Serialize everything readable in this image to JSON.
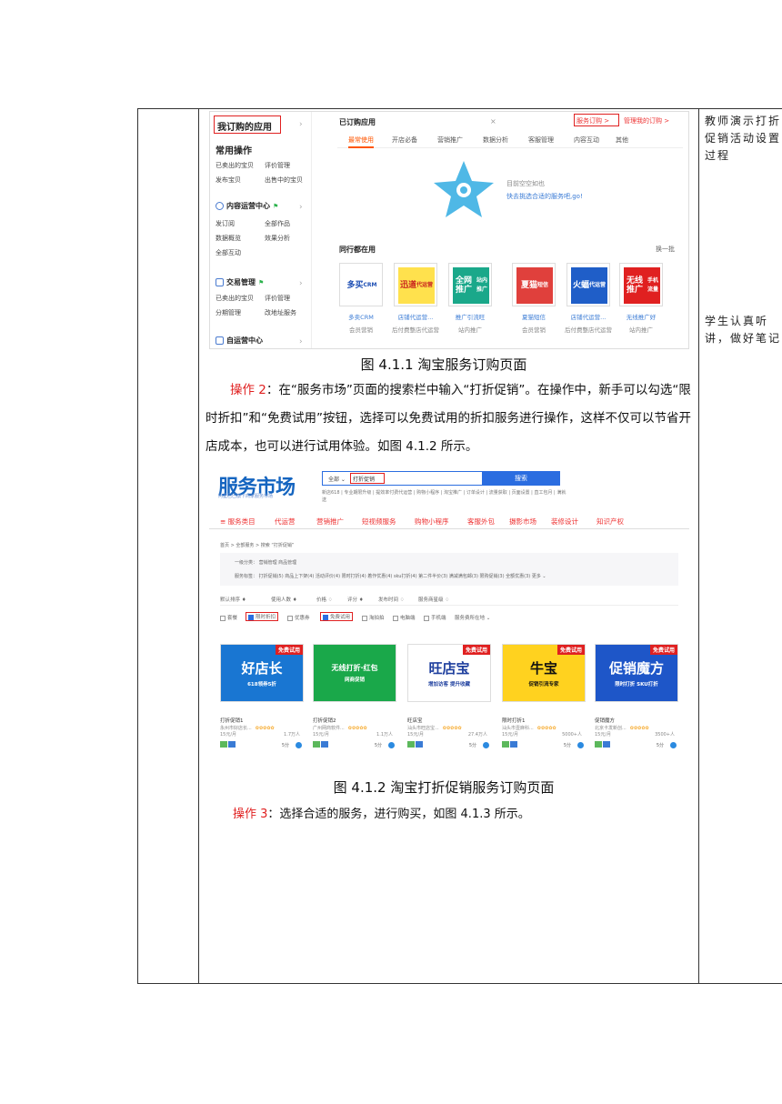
{
  "right_column": {
    "note_top": "教师演示打折促销活动设置过程",
    "note_bottom": "学生认真听讲，做好笔记"
  },
  "figure1": {
    "sidebar": {
      "my_apps": "我订购的应用",
      "common_ops": "常用操作",
      "common_links": [
        "已卖出的宝贝",
        "评价管理",
        "发布宝贝",
        "出售中的宝贝"
      ],
      "content_center": "内容运营中心",
      "content_links": [
        "发订阅",
        "全部作品",
        "数据概览",
        "效果分析",
        "全部互动"
      ],
      "trade_mgmt": "交易管理",
      "trade_links": [
        "已卖出的宝贝",
        "评价管理",
        "分期管理",
        "改地址服务"
      ],
      "self_ops": "自运营中心"
    },
    "header": {
      "title": "已订购应用",
      "close": "×",
      "service_order": "服务订购 >",
      "manage_order": "管理我的订购 >"
    },
    "tabs": [
      "最常使用",
      "开店必备",
      "营销推广",
      "数据分析",
      "客服管理",
      "内容互动",
      "其他"
    ],
    "empty": {
      "line1": "目前空空如也",
      "line2": "快去挑选合适的服务吧,go!"
    },
    "peers": {
      "title": "同行都在用",
      "swap": "换一批",
      "cards": [
        {
          "art": "多买",
          "art_sub": "CRM",
          "name": "多卖CRM",
          "category": "会员营销",
          "bg": "#ffffff",
          "fg": "#1e4fb4"
        },
        {
          "art": "迅道",
          "art_sub": "代运营",
          "name": "店铺代运营...",
          "category": "后付费整店代运营",
          "bg": "#ffe14d",
          "fg": "#c8201e"
        },
        {
          "art": "全网推广",
          "art_sub": "站内推广",
          "name": "推广引流旺",
          "category": "站内推广",
          "bg": "#1aa88a",
          "fg": "#ffffff"
        },
        {
          "art": "夏猫",
          "art_sub": "短信",
          "name": "夏猫短信",
          "category": "会员营销",
          "bg": "#e0403c",
          "fg": "#ffffff"
        },
        {
          "art": "火蝠",
          "art_sub": "代运营",
          "name": "店铺代运营...",
          "category": "后付费整店代运营",
          "bg": "#1f5ec8",
          "fg": "#ffffff"
        },
        {
          "art": "无线推广",
          "art_sub": "手机流量",
          "name": "无线推广好",
          "category": "站内推广",
          "bg": "#e02020",
          "fg": "#ffffff"
        }
      ]
    },
    "caption": "图 4.1.1  淘宝服务订购页面"
  },
  "paragraph1": {
    "op_label": "操作 2",
    "text": "：在“服务市场”页面的搜索栏中输入“打折促销”。在操作中，新手可以勾选“限时折扣”和“免费试用”按钮，选择可以免费试用的折扣服务进行操作，这样不仅可以节省开店成本，也可以进行试用体验。如图 4.1.2 所示。"
  },
  "figure2": {
    "logo": "服务市场",
    "logo_sub": "阿里巴巴旗下商家服务市场",
    "search_scope": "全部 ⌄",
    "search_query": "打折促销",
    "search_button": "搜索",
    "hot_words": "新店618 | 专业期限升级 | 提效率付费代运营 | 购物小程序 | 淘宝推广 | 订单设计 | 流量获取 | 页面设置 | 直工包月 | 满就送",
    "nav": [
      "≡ 服务类目",
      "代运营",
      "营销推广",
      "短视频服务",
      "购物小程序",
      "客服外包",
      "摄影市场",
      "装修设计",
      "知识产权"
    ],
    "breadcrumb": "首页 > 全部服务 > 搜索 “打折促销”",
    "filter_row1": "一级分类：  营销管理    商品管理",
    "filter_row2": "服务标签：  打折促销(5)    商品上下架(4)    活动评价(4)    限时打折(4)    着作优惠(4)    sku打折(4)    第二件半价(3)    满减满包邮(3)    限购促销(3)    全额优惠(3)         更多 ⌄",
    "sort": [
      "默认排序 ♦",
      "使用人数 ♦",
      "价格 ♢",
      "评分 ♦",
      "发布时间 ♢",
      "服务商星级 ♢"
    ],
    "checks": [
      "套餐",
      "限时折扣",
      "优惠券",
      "免费试用",
      "淘拍拍",
      "电脑端",
      "手机端",
      "服务费所在地 ⌄"
    ],
    "cards": [
      {
        "tag": "免费试用",
        "art": "好店长",
        "art_sub": "618领券5折",
        "title": "打折促销1",
        "vendor": "永州市好店长...",
        "price": "15元/月",
        "users": "1.7万人",
        "score": "5分",
        "bg": "#1976d2",
        "fg": "#ffffff"
      },
      {
        "tag": "",
        "art": "无线打折·红包",
        "art_sub": "网商促销",
        "title": "打折促销2",
        "vendor": "广州网商软件...",
        "price": "15元/月",
        "users": "1.1万人",
        "score": "5分",
        "bg": "#1aa84a",
        "fg": "#ffffff"
      },
      {
        "tag": "免费试用",
        "art": "旺店宝",
        "art_sub": "增加访客 提升收藏",
        "title": "旺店宝",
        "vendor": "汕头市旺店宝...",
        "price": "15元/月",
        "users": "27.4万人",
        "score": "5分",
        "bg": "#ffffff",
        "fg": "#1e3f9e"
      },
      {
        "tag": "免费试用",
        "art": "牛宝",
        "art_sub": "促销引流专家",
        "title": "限时打折1",
        "vendor": "汕头市壹麻科...",
        "price": "15元/月",
        "users": "5000+人",
        "score": "5分",
        "bg": "#ffd21f",
        "fg": "#111111"
      },
      {
        "tag": "免费试用",
        "art": "促销魔方",
        "art_sub": "限时打折 SKU打折",
        "title": "促销魔方",
        "vendor": "北京卡发新创...",
        "price": "15元/月",
        "users": "3500+人",
        "score": "5分",
        "bg": "#1e56c8",
        "fg": "#ffffff"
      }
    ],
    "caption": "图 4.1.2  淘宝打折促销服务订购页面"
  },
  "paragraph2": {
    "op_label": "操作 3",
    "text": "：选择合适的服务，进行购买，如图 4.1.3 所示。"
  }
}
